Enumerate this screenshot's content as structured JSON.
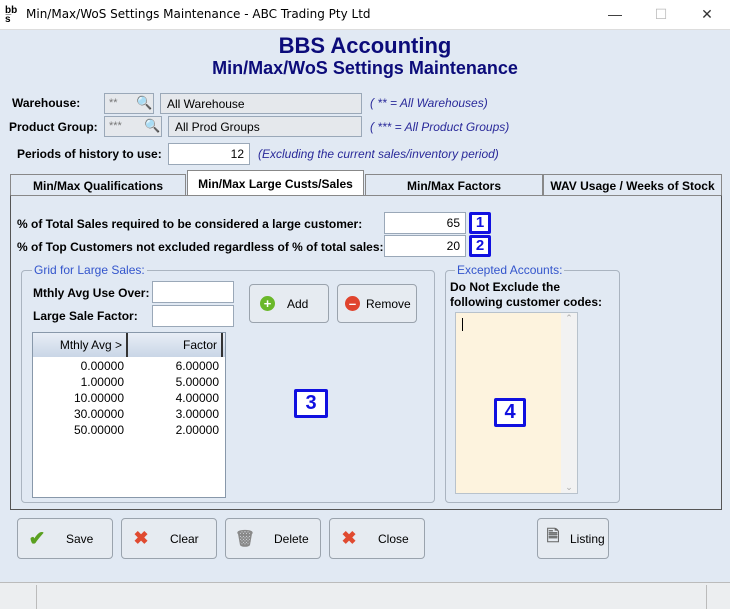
{
  "window": {
    "title": "Min/Max/WoS Settings Maintenance - ABC Trading Pty Ltd",
    "app_icon": "bbs-logo-icon"
  },
  "header": {
    "title": "BBS Accounting",
    "subtitle": "Min/Max/WoS Settings Maintenance"
  },
  "filters": {
    "warehouse": {
      "label": "Warehouse:",
      "code": "**",
      "description": "All Warehouse",
      "note": "( ** = All Warehouses)"
    },
    "product_group": {
      "label": "Product Group:",
      "code": "***",
      "description": "All Prod Groups",
      "note": "( *** = All Product Groups)"
    },
    "periods": {
      "label": "Periods of history to use:",
      "value": "12",
      "note": "(Excluding the current sales/inventory period)"
    }
  },
  "tabs": [
    {
      "label": "Min/Max Qualifications",
      "active": false
    },
    {
      "label": "Min/Max Large Custs/Sales",
      "active": true
    },
    {
      "label": "Min/Max Factors",
      "active": false
    },
    {
      "label": "WAV Usage / Weeks of Stock",
      "active": false
    }
  ],
  "large": {
    "pct_total_label": "% of Total Sales required to be considered a large customer:",
    "pct_total_value": "65",
    "pct_top_label": "% of Top Customers not excluded regardless of % of total sales:",
    "pct_top_value": "20"
  },
  "badges": [
    "1",
    "2",
    "3",
    "4"
  ],
  "grid_group": {
    "legend": "Grid for Large Sales:",
    "mthly_label": "Mthly Avg Use Over:",
    "mthly_value": "",
    "factor_label": "Large Sale Factor:",
    "factor_value": "",
    "add_label": "Add",
    "remove_label": "Remove",
    "columns": [
      "Mthly Avg >",
      "Factor"
    ],
    "rows": [
      [
        "0.00000",
        "6.00000"
      ],
      [
        "1.00000",
        "5.00000"
      ],
      [
        "10.00000",
        "4.00000"
      ],
      [
        "30.00000",
        "3.00000"
      ],
      [
        "50.00000",
        "2.00000"
      ]
    ]
  },
  "excepted": {
    "legend": "Excepted Accounts:",
    "label": "Do Not Exclude the following customer codes:",
    "value": ""
  },
  "buttons": {
    "save": "Save",
    "clear": "Clear",
    "delete": "Delete",
    "close": "Close",
    "listing": "Listing"
  }
}
